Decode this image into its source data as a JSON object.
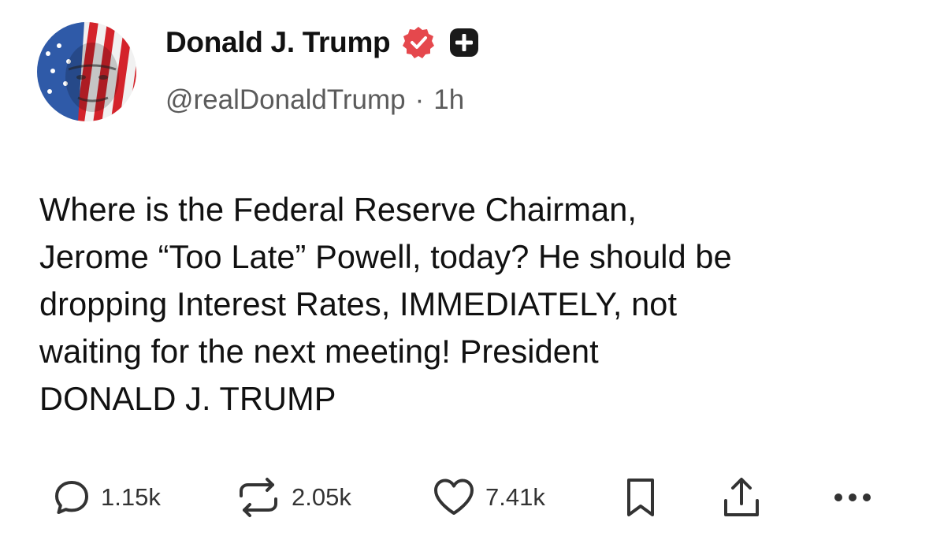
{
  "post": {
    "display_name": "Donald J. Trump",
    "handle": "@realDonaldTrump",
    "separator": "·",
    "time_ago": "1h",
    "verified_icon": "verified-badge-icon",
    "badge_icon": "plus-badge-icon",
    "text": "Where is the Federal Reserve Chairman,\nJerome “Too Late” Powell, today? He should be\ndropping Interest Rates, IMMEDIATELY, not\nwaiting for the next meeting! President\nDONALD J. TRUMP"
  },
  "actions": {
    "reply_count": "1.15k",
    "repost_count": "2.05k",
    "like_count": "7.41k",
    "icons": [
      "reply-icon",
      "repost-icon",
      "like-icon",
      "bookmark-icon",
      "share-icon",
      "more-icon"
    ]
  },
  "colors": {
    "verified": "#e5484d",
    "plus_badge": "#1a1a1a",
    "text": "#111111",
    "muted": "#5b5b5b"
  }
}
